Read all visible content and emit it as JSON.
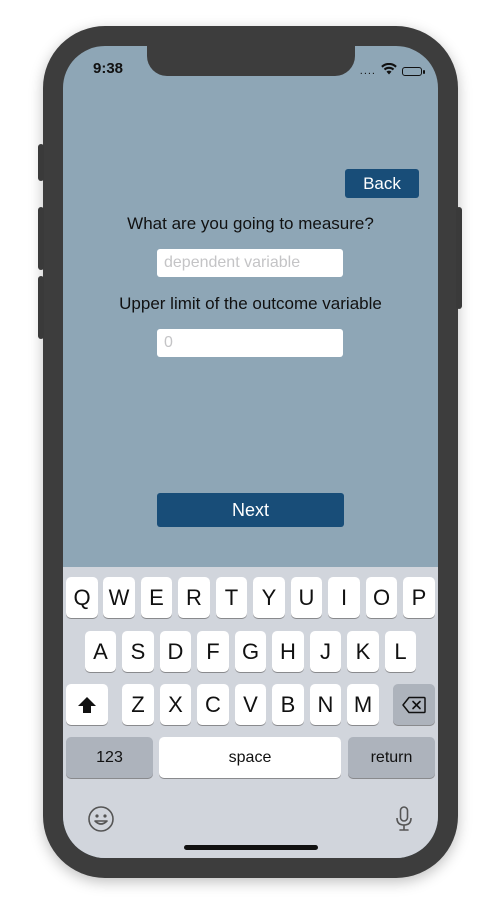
{
  "status": {
    "time": "9:38",
    "signal": "...."
  },
  "nav": {
    "back_label": "Back"
  },
  "form": {
    "measure_label": "What are you going to measure?",
    "measure_placeholder": "dependent variable",
    "measure_value": "",
    "upper_label": "Upper limit of the outcome variable",
    "upper_placeholder": "0",
    "upper_value": ""
  },
  "next_label": "Next",
  "keyboard": {
    "row1": [
      "Q",
      "W",
      "E",
      "R",
      "T",
      "Y",
      "U",
      "I",
      "O",
      "P"
    ],
    "row2": [
      "A",
      "S",
      "D",
      "F",
      "G",
      "H",
      "J",
      "K",
      "L"
    ],
    "row3": [
      "Z",
      "X",
      "C",
      "V",
      "B",
      "N",
      "M"
    ],
    "numbers_label": "123",
    "space_label": "space",
    "return_label": "return",
    "icons": [
      "shift-icon",
      "backspace-icon",
      "emoji-icon",
      "microphone-icon"
    ]
  },
  "colors": {
    "accent": "#184d78",
    "background": "#8ea6b6",
    "keyboard": "#d1d5dc"
  }
}
